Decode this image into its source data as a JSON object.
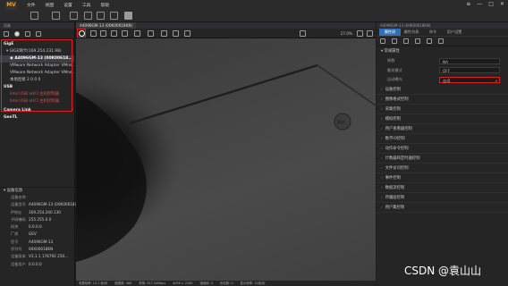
{
  "app": {
    "logo": "MV"
  },
  "menu": [
    "文件",
    "视图",
    "设置",
    "工具",
    "帮助"
  ],
  "window_controls": [
    "≡",
    "—",
    "□",
    "✕"
  ],
  "left_panel": {
    "header": "设备",
    "tree": [
      {
        "label": "GigE",
        "style": "bold"
      },
      {
        "label": "▾ GIGE网卡(169.254.231.98)",
        "style": "normal"
      },
      {
        "label": "◉ A4096GM-13 (00K00618...",
        "style": "sel"
      },
      {
        "label": "VMware Network Adapter VMne...",
        "style": "normal"
      },
      {
        "label": "VMware Network Adapter VMne...",
        "style": "normal"
      },
      {
        "label": "本地连接 2 0 0 0",
        "style": "normal"
      },
      {
        "label": "USB",
        "style": "bold"
      },
      {
        "label": "Intel USB xHCI 主机控制器",
        "style": "red"
      },
      {
        "label": "Intel USB xHCI 主机控制器",
        "style": "red"
      },
      {
        "label": "Camera Link",
        "style": "bold"
      },
      {
        "label": "GenTL",
        "style": "bold"
      }
    ]
  },
  "device_info": {
    "header": "▾ 设备信息",
    "rows": [
      {
        "k": "设备名称",
        "v": ""
      },
      {
        "k": "设备型号",
        "v": "A4096GM-13 (00K00618)"
      },
      {
        "k": "IP地址",
        "v": "169.254.240.130"
      },
      {
        "k": "子网掩码",
        "v": "255.255.0.0"
      },
      {
        "k": "网关",
        "v": "0.0.0.0"
      },
      {
        "k": "厂商",
        "v": "GEV"
      },
      {
        "k": "型号",
        "v": "A4096GM-13"
      },
      {
        "k": "序列号",
        "v": "00K00618KN"
      },
      {
        "k": "设备版本",
        "v": "V3.1.1 178792 250..."
      },
      {
        "k": "设备用户",
        "v": "0.0.0.0"
      }
    ]
  },
  "center": {
    "tab": "A4096GM-13 (00K00618KN)",
    "zoom": "27.0%",
    "status": [
      "采集帧率: 13.1 帧/秒",
      "图像数: 466",
      "带宽: 927.04Mbps",
      "4096 × 2160",
      "错误帧: 0",
      "丢包数: 0",
      "显示帧率: 13帧/秒"
    ]
  },
  "right_panel": {
    "header": "A4096GM-13 (00K00618KN)",
    "tabs": [
      "属性树",
      "属性列表",
      "命令",
      "用户设置"
    ],
    "sections_top": [
      "▾ 常规属性"
    ],
    "props": [
      {
        "k": "帧数",
        "v": "NA",
        "selected": false
      },
      {
        "k": "触发模式",
        "v": "OFF",
        "selected": false
      },
      {
        "k": "自动曝光",
        "v": "连续",
        "selected": true
      }
    ],
    "sections": [
      "设备控制",
      "图像格式控制",
      "采集控制",
      "模拟控制",
      "用户查看器控制",
      "数字IO控制",
      "动作命令控制",
      "计数器和定时器控制",
      "文件访问控制",
      "事件控制",
      "数据流控制",
      "传输层控制",
      "用户集控制"
    ]
  },
  "watermark": "CSDN @袁山山",
  "colors": {
    "highlight_red": "#e02020",
    "active_tab_blue": "#2f6fb6"
  }
}
